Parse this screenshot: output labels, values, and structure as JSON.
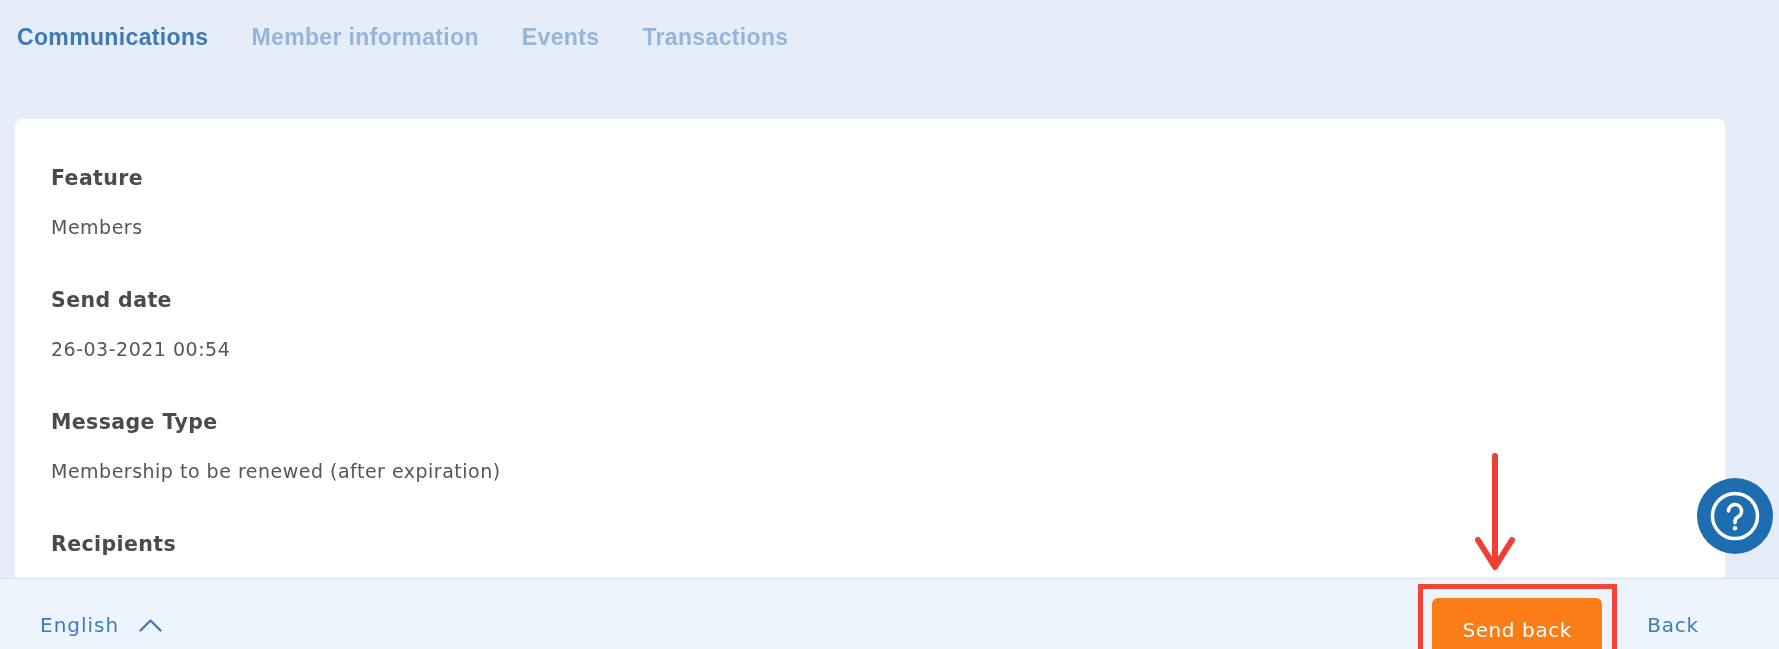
{
  "tabs": [
    {
      "label": "Communications",
      "selected": true
    },
    {
      "label": "Member information",
      "selected": false
    },
    {
      "label": "Events",
      "selected": false
    },
    {
      "label": "Transactions",
      "selected": false
    }
  ],
  "details": [
    {
      "label": "Feature",
      "value": "Members"
    },
    {
      "label": "Send date",
      "value": "26-03-2021 00:54"
    },
    {
      "label": "Message Type",
      "value": "Membership to be renewed (after expiration)"
    },
    {
      "label": "Recipients"
    }
  ],
  "footer": {
    "language": "English",
    "buttons": [
      {
        "label": "Send back",
        "kind": "primary",
        "highlighted": true
      },
      {
        "label": "Back",
        "kind": "link",
        "highlighted": false
      }
    ]
  }
}
